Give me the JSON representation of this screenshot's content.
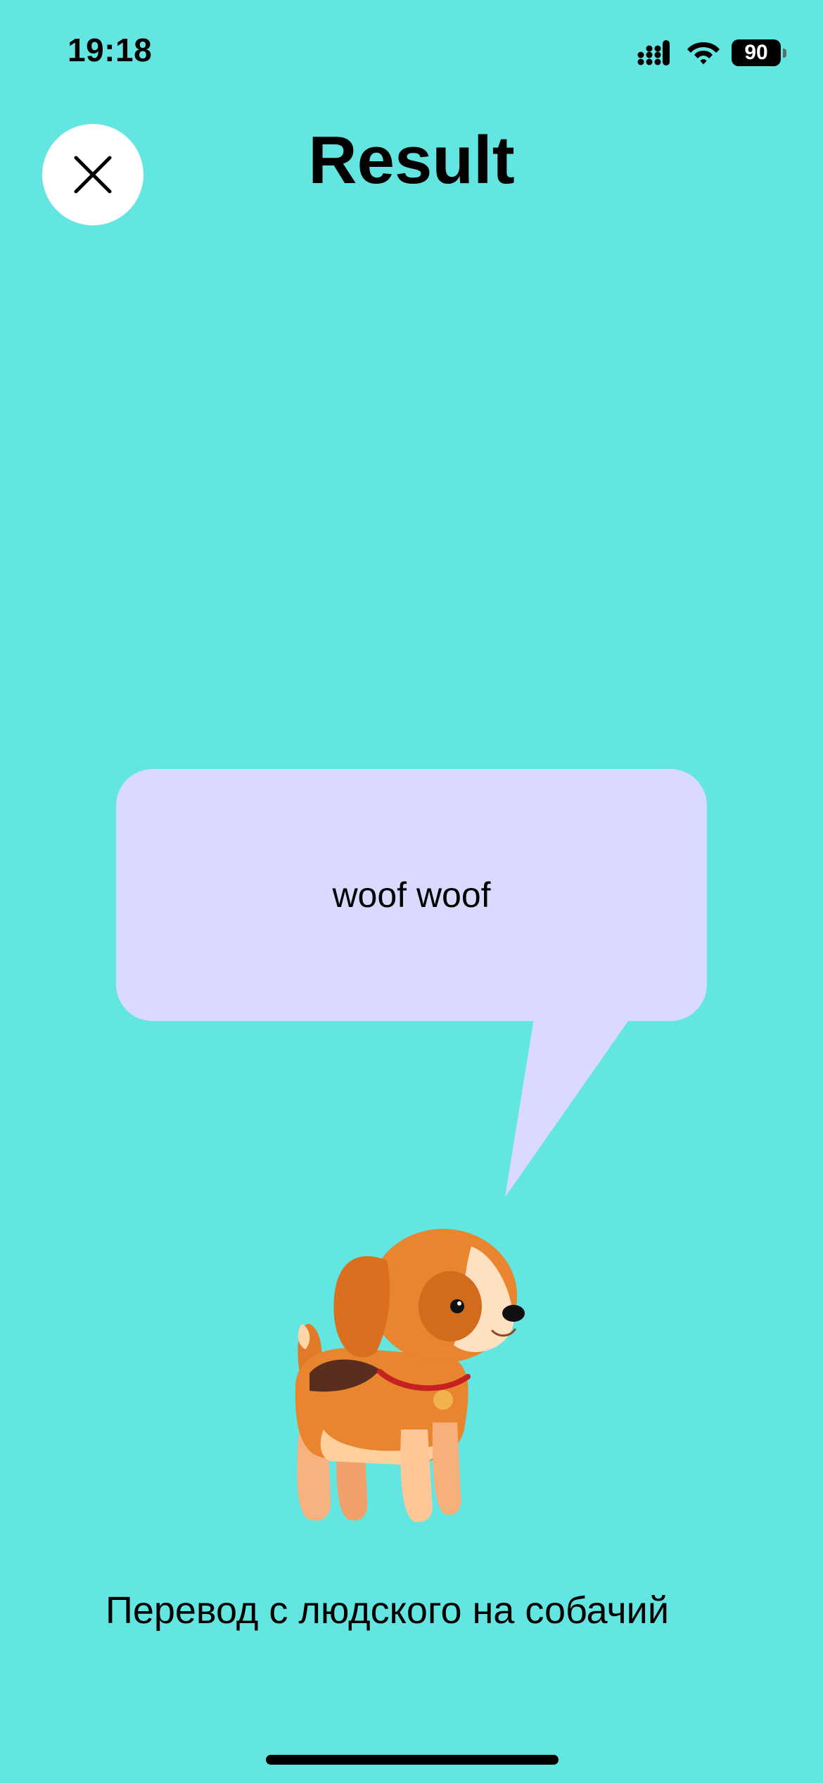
{
  "colors": {
    "background": "#63e6e1",
    "bubble": "#dad9ff",
    "close_button_bg": "#ffffff",
    "text": "#000000"
  },
  "status_bar": {
    "time": "19:18",
    "battery_level": "90",
    "icons": [
      "cellular-signal-icon",
      "wifi-icon",
      "battery-icon"
    ]
  },
  "header": {
    "title": "Result",
    "close_icon": "close-icon"
  },
  "bubble": {
    "text": "woof woof"
  },
  "illustration": "dog-illustration",
  "subtitle": "Перевод с людского на собачий"
}
